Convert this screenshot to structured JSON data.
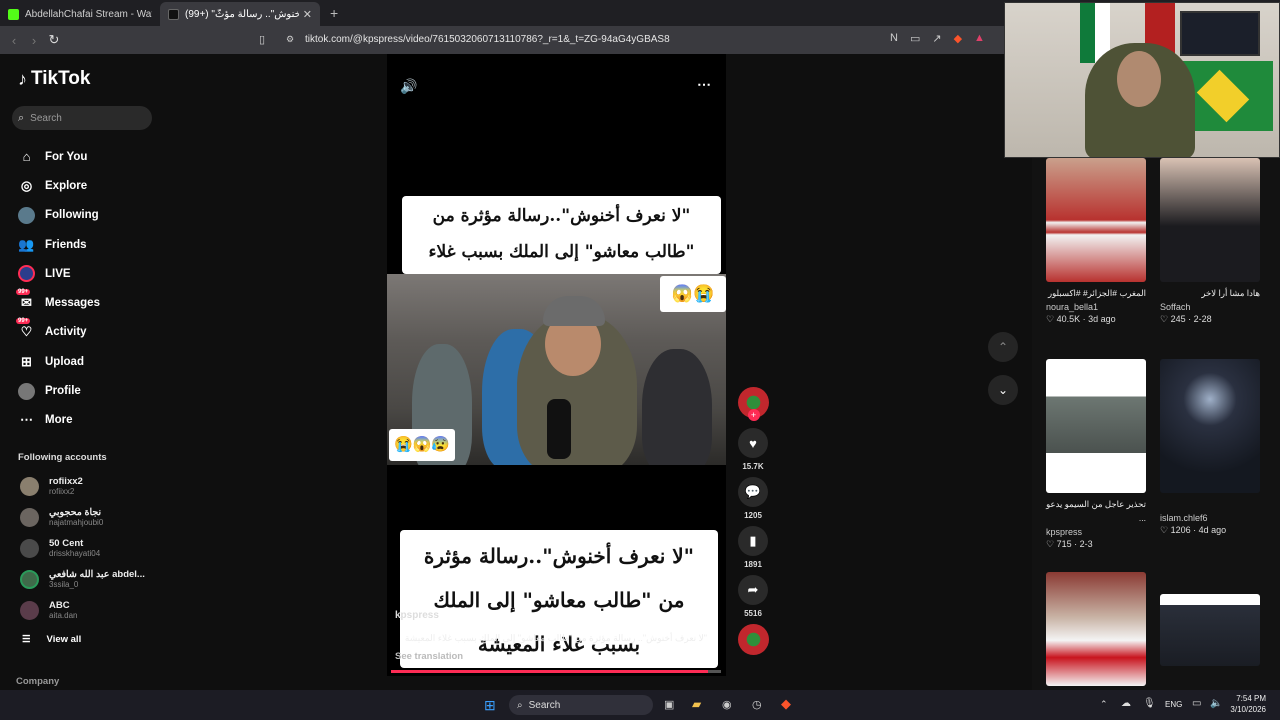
{
  "browser": {
    "tabs": [
      {
        "title": "AbdellahChafai Stream - Watch Live",
        "active": false
      },
      {
        "title": "(99+) \"لا نعرف أخنوش\".. رسالة مؤثّ",
        "active": true
      }
    ],
    "url": "tiktok.com/@kpspress/video/7615032060713110786?_r=1&_t=ZG-94aG4yGBAS8"
  },
  "tiktok": {
    "logo": "TikTok",
    "search_placeholder": "Search",
    "menu": [
      {
        "label": "For You",
        "icon": "home-icon"
      },
      {
        "label": "Explore",
        "icon": "compass-icon"
      },
      {
        "label": "Following",
        "icon": "following-avatar-icon"
      },
      {
        "label": "Friends",
        "icon": "friends-icon"
      },
      {
        "label": "LIVE",
        "icon": "live-icon"
      },
      {
        "label": "Messages",
        "icon": "messages-icon",
        "badge": "99+"
      },
      {
        "label": "Activity",
        "icon": "activity-icon",
        "badge": "99+"
      },
      {
        "label": "Upload",
        "icon": "upload-icon"
      },
      {
        "label": "Profile",
        "icon": "profile-icon"
      },
      {
        "label": "More",
        "icon": "more-icon"
      }
    ],
    "following_title": "Following accounts",
    "accounts": [
      {
        "name": "rofiixx2",
        "handle": "rofiixx2"
      },
      {
        "name": "نجاة محجوبي",
        "handle": "najatmahjoubi0"
      },
      {
        "name": "50 Cent",
        "handle": "drisskhayati04"
      },
      {
        "name": "عبد الله شافعي abdel...",
        "handle": "3ssila_0"
      },
      {
        "name": "ABC",
        "handle": "aita.dan"
      }
    ],
    "view_all": "View all",
    "company": "Company"
  },
  "video": {
    "headline": "\"لا نعرف أخنوش\"..رسالة مؤثرة من \"طالب معاشو\" إلى الملك بسبب غلاء المعيشة",
    "headline_bottom": "\"لا نعرف أخنوش\"..رسالة مؤثرة من \"طالب معاشو\" إلى الملك بسبب غلاء المعيشة",
    "emoji_top": "😱😭",
    "emoji_bottom": "😭😱😰",
    "author": "kpspress",
    "description": "\"لا نعرف أخنوش\".. رسالة مؤثرة من \"طالب معاشو\" إلى الملك بسبب غلاء المعيشة",
    "see_translation": "See translation",
    "progress": 0.96,
    "likes": "15.7K",
    "comments": "1205",
    "saves": "1891",
    "shares": "5516"
  },
  "related": [
    {
      "title": "المغرب #الجزائر# #اكسبلور",
      "user": "noura_bella1",
      "stats": "40.5K · 3d ago"
    },
    {
      "title": "هادا مشا أرا لاخر",
      "user": "Soffach",
      "stats": "245 · 2-28"
    },
    {
      "title": "تحذير عاجل من السيمو يدعو ...",
      "user": "kpspress",
      "stats": "715 · 2-3"
    },
    {
      "title": "",
      "user": "islam.chlef6",
      "stats": "1206 · 4d ago"
    }
  ],
  "taskbar": {
    "search": "Search",
    "lang": "ENG",
    "time": "7:54 PM",
    "date": "3/10/2026"
  }
}
